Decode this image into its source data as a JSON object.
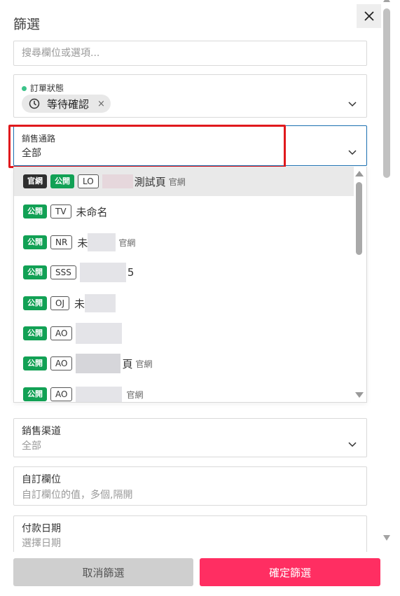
{
  "header": {
    "title": "篩選",
    "close_icon": "close-icon"
  },
  "search": {
    "placeholder": "搜尋欄位或選項..."
  },
  "order_status": {
    "label": "訂單狀態",
    "dot_color": "#3cc38a",
    "chip_label": "等待確認",
    "chip_remove": "×"
  },
  "sales_channel_field": {
    "label": "銷售通路",
    "value": "全部"
  },
  "channel_options": [
    {
      "tags": [
        "官網",
        "公開"
      ],
      "code": "LO",
      "name": "測試頁",
      "suffix": "官網",
      "active": true
    },
    {
      "tags": [
        "公開"
      ],
      "code": "TV",
      "name": "未命名",
      "suffix": ""
    },
    {
      "tags": [
        "公開"
      ],
      "code": "NR",
      "name": "未",
      "suffix": "官網"
    },
    {
      "tags": [
        "公開"
      ],
      "code": "SSS",
      "name": "5",
      "suffix": ""
    },
    {
      "tags": [
        "公開"
      ],
      "code": "OJ",
      "name": "未",
      "suffix": ""
    },
    {
      "tags": [
        "公開"
      ],
      "code": "AO",
      "name": "",
      "suffix": ""
    },
    {
      "tags": [
        "公開"
      ],
      "code": "AO",
      "name": "頁",
      "suffix": "官網"
    },
    {
      "tags": [
        "公開"
      ],
      "code": "AO",
      "name": "",
      "suffix": "官網"
    }
  ],
  "sales_channel2": {
    "label": "銷售渠道",
    "value": "全部"
  },
  "custom_field": {
    "label": "自訂欄位",
    "placeholder": "自訂欄位的值，多個,隔開"
  },
  "payment_date": {
    "label": "付款日期",
    "placeholder": "選擇日期"
  },
  "footer": {
    "cancel_label": "取消篩選",
    "confirm_label": "確定篩選"
  },
  "colors": {
    "accent": "#ff2e62",
    "public_tag": "#12a155",
    "official_tag": "#2f2f2f",
    "highlight": "#e0191d"
  }
}
